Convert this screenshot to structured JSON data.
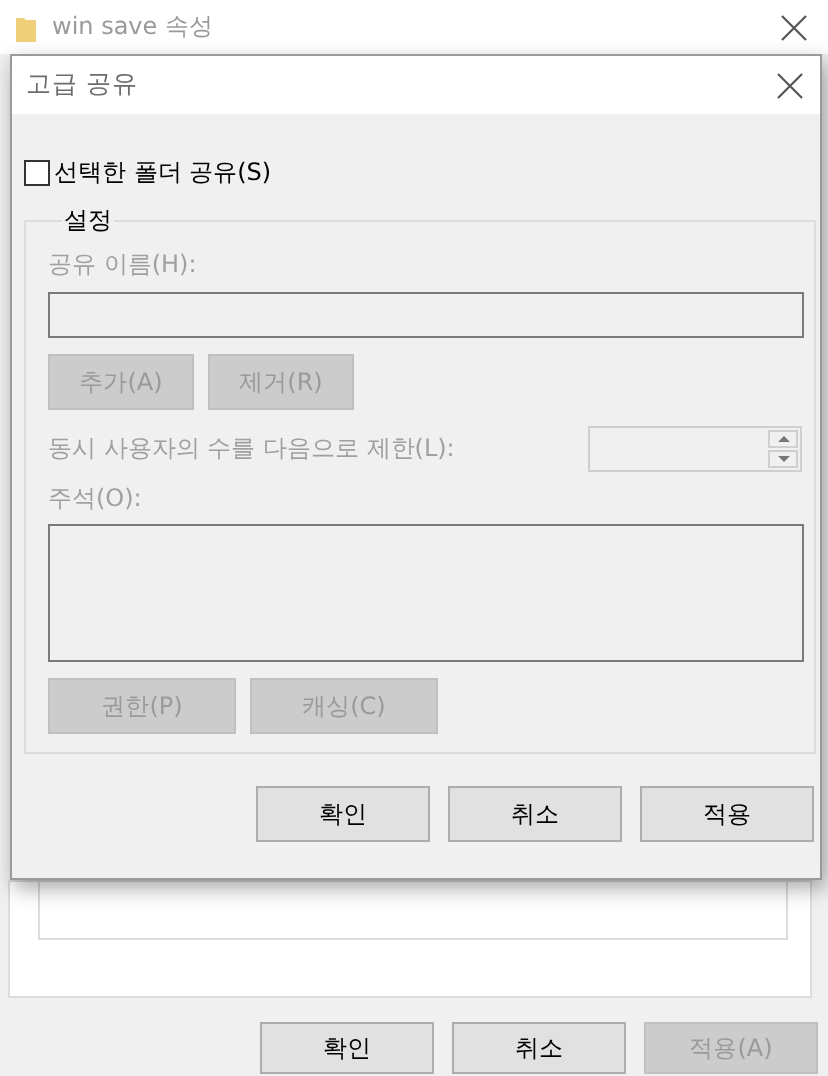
{
  "background_window": {
    "title": "win save 속성",
    "buttons": [
      {
        "label": "확인",
        "disabled": false
      },
      {
        "label": "취소",
        "disabled": false
      },
      {
        "label": "적용(A)",
        "disabled": true
      }
    ]
  },
  "dialog": {
    "title": "고급 공유",
    "share_checkbox": {
      "label": "선택한 폴더 공유(S)",
      "checked": false
    },
    "settings": {
      "title": "설정",
      "disabled": true,
      "share_name_label": "공유 이름(H):",
      "name_buttons": [
        "추가(A)",
        "제거(R)"
      ],
      "user_limit_label": "동시 사용자의 수를 다음으로 제한(L):",
      "comment_label": "주석(O):",
      "bottom_buttons": [
        "권한(P)",
        "캐싱(C)"
      ]
    },
    "buttons": [
      "확인",
      "취소",
      "적용"
    ]
  }
}
